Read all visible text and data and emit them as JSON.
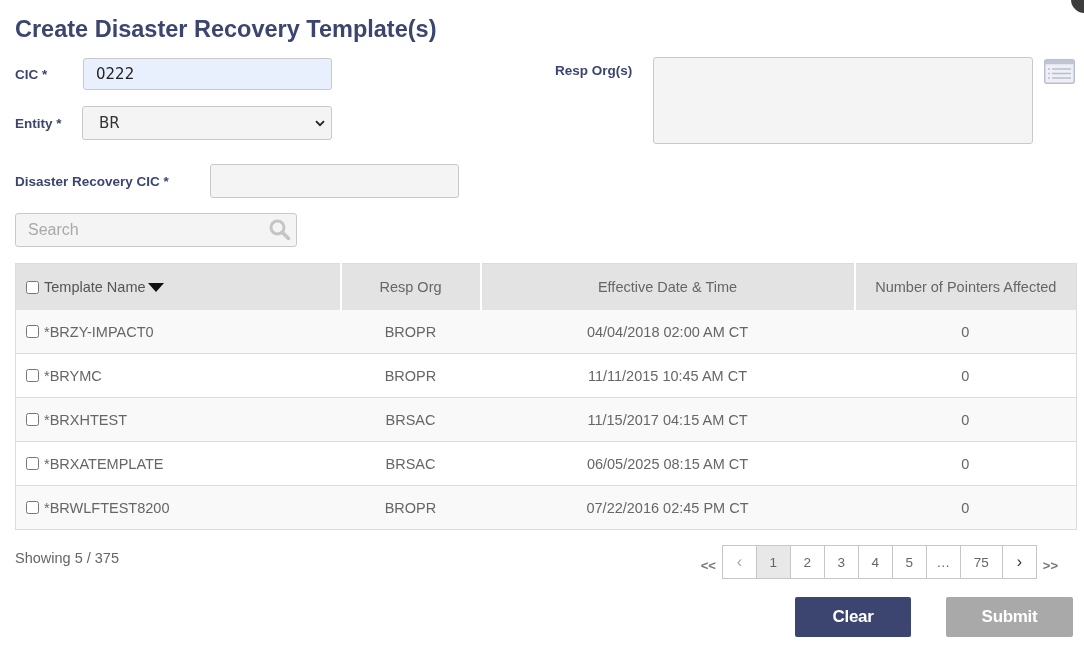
{
  "title": "Create Disaster Recovery Template(s)",
  "form": {
    "cic": {
      "label": "CIC *",
      "value": "0222"
    },
    "entity": {
      "label": "Entity *",
      "value": "BR"
    },
    "resp_orgs": {
      "label": "Resp Org(s)"
    },
    "disaster_recovery_cic": {
      "label": "Disaster Recovery CIC *"
    }
  },
  "search": {
    "placeholder": "Search"
  },
  "table": {
    "select_all_checked": false,
    "columns": [
      {
        "label": "Template Name",
        "sorted": true
      },
      {
        "label": "Resp Org",
        "sorted": false
      },
      {
        "label": "Effective Date & Time",
        "sorted": false
      },
      {
        "label": "Number of Pointers Affected",
        "sorted": false
      }
    ],
    "rows": [
      {
        "checked": false,
        "cells": [
          "*BRZY-IMPACT0",
          "BROPR",
          "04/04/2018 02:00 AM CT",
          "0"
        ]
      },
      {
        "checked": false,
        "cells": [
          "*BRYMC",
          "BROPR",
          "11/11/2015 10:45 AM CT",
          "0"
        ]
      },
      {
        "checked": false,
        "cells": [
          "*BRXHTEST",
          "BRSAC",
          "11/15/2017 04:15 AM CT",
          "0"
        ]
      },
      {
        "checked": false,
        "cells": [
          "*BRXATEMPLATE",
          "BRSAC",
          "06/05/2025 08:15 AM CT",
          "0"
        ]
      },
      {
        "checked": false,
        "cells": [
          "*BRWLFTEST8200",
          "BROPR",
          "07/22/2016 02:45 PM CT",
          "0"
        ]
      }
    ]
  },
  "showing": "Showing 5 / 375",
  "pagination": {
    "first": "<<",
    "prev": {
      "label": "‹",
      "disabled": true
    },
    "pages": [
      {
        "label": "1",
        "selected": true
      },
      {
        "label": "2",
        "selected": false
      },
      {
        "label": "3",
        "selected": false
      },
      {
        "label": "4",
        "selected": false
      },
      {
        "label": "5",
        "selected": false
      },
      {
        "label": "…",
        "selected": false
      },
      {
        "label": "75",
        "selected": false
      }
    ],
    "next": {
      "label": "›",
      "disabled": false
    },
    "last": ">>"
  },
  "buttons": [
    {
      "label": "Clear",
      "disabled": false
    },
    {
      "label": "Submit",
      "disabled": true
    }
  ]
}
